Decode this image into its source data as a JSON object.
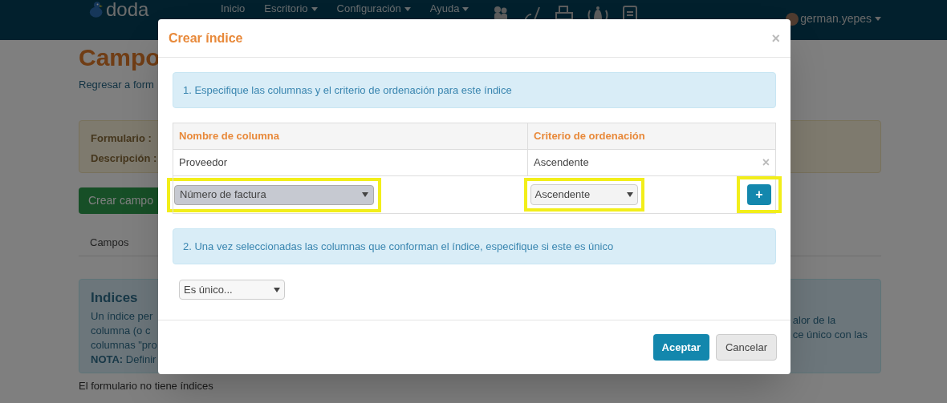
{
  "navbar": {
    "logo": "doda",
    "menu": [
      {
        "label": "Inicio",
        "dropdown": false
      },
      {
        "label": "Escritorio",
        "dropdown": true
      },
      {
        "label": "Configuración",
        "dropdown": true
      },
      {
        "label": "Ayuda",
        "dropdown": true
      }
    ],
    "user": "german.yepes"
  },
  "page": {
    "title": "Campo",
    "back_link": "Regresar a form",
    "form_info": [
      "Formulario :",
      "Descripción :"
    ],
    "create_button": "Crear campo",
    "tabs": [
      {
        "label": "Campos",
        "selected": false
      }
    ],
    "indices_panel": {
      "title": "Indices",
      "lines_left": [
        "Un índice per",
        "columna (o c",
        "columnas \"pro",
        "**NOTA:** Definir"
      ],
      "lines_right": [
        "alor de la",
        "ce único con las"
      ]
    },
    "empty_message": "El formulario no tiene índices"
  },
  "modal": {
    "title": "Crear índice",
    "close": "×",
    "step1": "1. Especifique las columnas y el criterio de ordenación para este índice",
    "columns": [
      "Nombre de columna",
      "Criterio de ordenación"
    ],
    "rows": [
      {
        "column": "Proveedor",
        "order": "Ascendente",
        "remove": "×"
      }
    ],
    "new_row": {
      "column_select": {
        "value": "Número de factura",
        "highlighted": true
      },
      "order_select": {
        "value": "Ascendente",
        "highlighted": true
      },
      "add_button": {
        "label": "+",
        "highlighted": true
      }
    },
    "step2": "2. Una vez seleccionadas las columnas que conforman el índice, especifique si este es único",
    "unique_select": {
      "value": "Es único..."
    },
    "buttons": [
      {
        "label": "Aceptar",
        "kind": "primary"
      },
      {
        "label": "Cancelar",
        "kind": "default"
      }
    ]
  }
}
